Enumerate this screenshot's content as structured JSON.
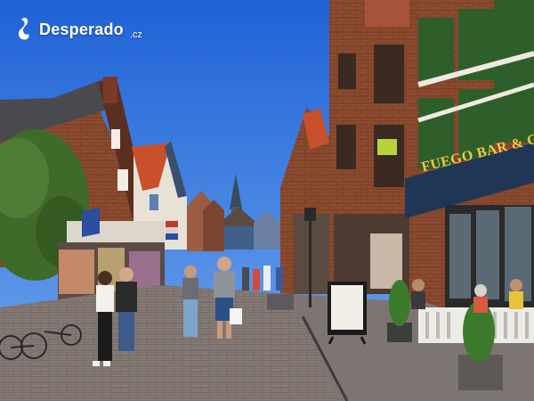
{
  "watermark": {
    "name": "Desperado",
    "tld": ".cz"
  },
  "restaurant_sign": "FUEGO BAR & GRILL",
  "scene_colors": {
    "sky": "#2b6fd8",
    "brick": "#8b4a2e",
    "roof": "#c8502a",
    "cobblestone": "#8a7f7a",
    "foliage": "#3f6b2a",
    "sign_gold": "#f4c64a",
    "awning_navy": "#1f3656"
  }
}
